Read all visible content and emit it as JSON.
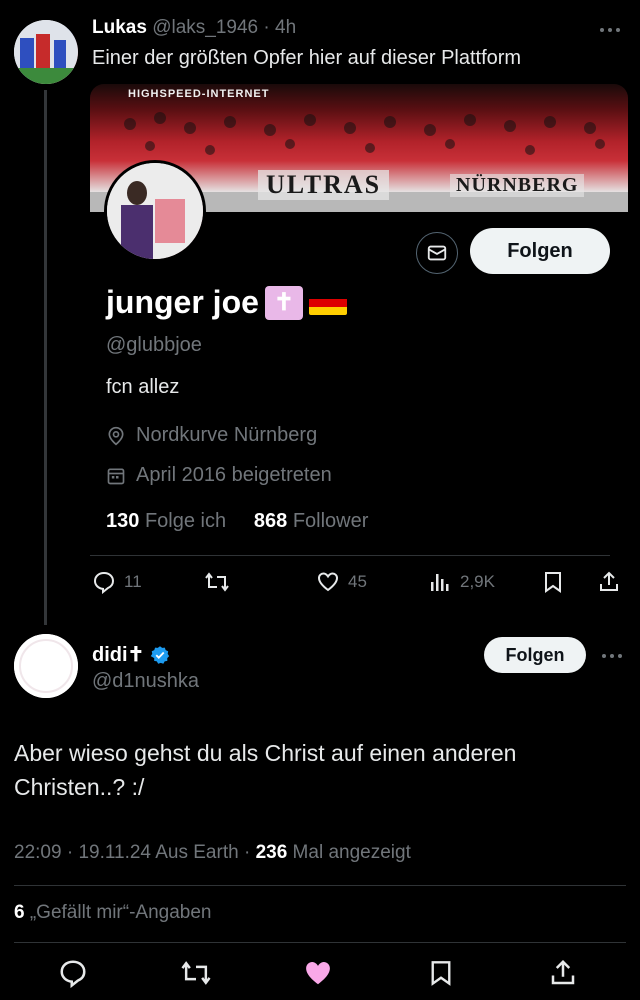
{
  "tweet1": {
    "author_name": "Lukas",
    "handle": "@laks_1946",
    "time": "4h",
    "text": "Einer der größten Opfer hier auf dieser Plattform",
    "profile_card": {
      "banner_text_top": "HIGHSPEED-INTERNET",
      "banner_text_ultras": "ULTRAS",
      "banner_text_city": "NÜRNBERG",
      "name": "junger joe",
      "handle": "@glubbjoe",
      "bio": "fcn allez",
      "location": "Nordkurve Nürnberg",
      "joined": "April 2016 beigetreten",
      "following_count": "130",
      "following_label": "Folge ich",
      "followers_count": "868",
      "followers_label": "Follower",
      "follow_label": "Folgen"
    },
    "actions": {
      "replies": "11",
      "likes": "45",
      "views": "2,9K"
    }
  },
  "tweet2": {
    "author_name": "didi✝",
    "handle": "@d1nushka",
    "follow_label": "Folgen",
    "text": "Aber wieso gehst du als Christ auf einen anderen Christen..? :/",
    "time": "22:09",
    "date": "19.11.24",
    "location": "Aus Earth",
    "views_count": "236",
    "views_label": "Mal angezeigt",
    "likes_count": "6",
    "likes_label": "„Gefällt mir“-Angaben"
  },
  "colors": {
    "background": "#000000",
    "text": "#e7e9ea",
    "muted": "#71767b",
    "verified": "#1d9bf0",
    "liked": "#f91880"
  }
}
